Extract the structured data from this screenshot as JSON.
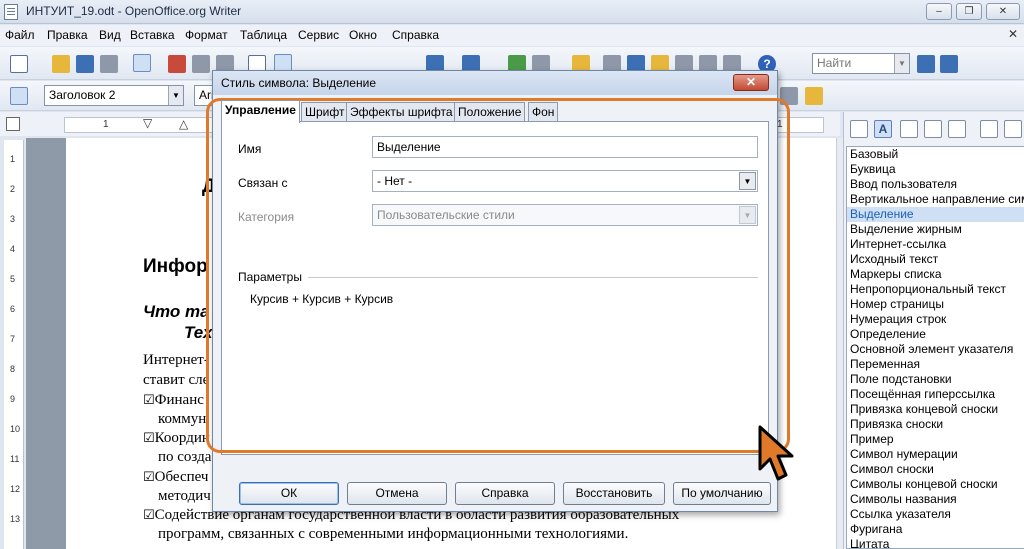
{
  "window": {
    "title": "ИНТУИТ_19.odt - OpenOffice.org Writer",
    "minimize": "–",
    "restore": "❐",
    "close": "✕"
  },
  "menu": {
    "items": [
      "Файл",
      "Правка",
      "Вид",
      "Вставка",
      "Формат",
      "Таблица",
      "Сервис",
      "Окно",
      "Справка"
    ],
    "close": "✕"
  },
  "toolbar": {
    "find_placeholder": "Найти",
    "paragraph_style": "Заголовок 2",
    "font_name": "Ari"
  },
  "ruler": {
    "marks": [
      "1",
      "1"
    ]
  },
  "vruler": {
    "marks": [
      "1",
      "2",
      "3",
      "4",
      "5",
      "6",
      "7",
      "8",
      "9",
      "10",
      "11",
      "12",
      "13"
    ]
  },
  "document": {
    "title_fragment": "Д",
    "heading": "Инфор",
    "subheading_line1": "Что та",
    "subheading_line2": "Тех",
    "para_line1": "Интернет-",
    "para_line2": "ставит сле",
    "bullets": [
      {
        "line1": "Финанс",
        "line2": "коммун"
      },
      {
        "line1": "Координ",
        "line2": "по созда"
      },
      {
        "line1": "Обеспеч",
        "line2": "методич"
      },
      {
        "line1": "Содействие органам государственной власти в области развития образовательных",
        "line2": "программ, связанных с современными информационными технологиями."
      }
    ],
    "check_glyph": "☑"
  },
  "stylist": {
    "styles": [
      "Базовый",
      "Буквица",
      "Ввод пользователя",
      "Вертикальное направление символов",
      "Выделение",
      "Выделение жирным",
      "Интернет-ссылка",
      "Исходный текст",
      "Маркеры списка",
      "Непропорциональный текст",
      "Номер страницы",
      "Нумерация строк",
      "Определение",
      "Основной элемент указателя",
      "Переменная",
      "Поле подстановки",
      "Посещённая гиперссылка",
      "Привязка концевой сноски",
      "Привязка сноски",
      "Пример",
      "Символ нумерации",
      "Символ сноски",
      "Символы концевой сноски",
      "Символы названия",
      "Ссылка указателя",
      "Фуригана",
      "Цитата"
    ],
    "selected_index": 4,
    "char_styles_icon_label": "A"
  },
  "dialog": {
    "title": "Стиль символа: Выделение",
    "close": "✕",
    "tabs": [
      "Управление",
      "Шрифт",
      "Эффекты шрифта",
      "Положение",
      "Фон"
    ],
    "active_tab": 0,
    "name_label": "Имя",
    "name_value": "Выделение",
    "linked_label": "Связан с",
    "linked_value": "- Нет -",
    "category_label": "Категория",
    "category_value": "Пользовательские стили",
    "params_label": "Параметры",
    "params_value": "Курсив + Курсив + Курсив",
    "buttons": {
      "ok": "ОК",
      "cancel": "Отмена",
      "help": "Справка",
      "restore": "Восстановить",
      "default": "По умолчанию"
    }
  },
  "colors": {
    "highlight": "#e0792a",
    "selection": "#cfe0f5"
  }
}
